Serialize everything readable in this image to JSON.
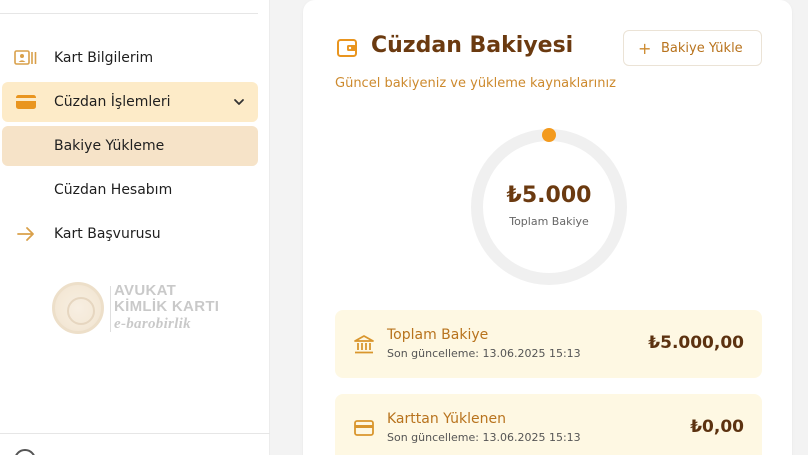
{
  "sidebar": {
    "items": [
      {
        "label": "Kart Bilgilerim",
        "icon": "id-card-icon"
      },
      {
        "label": "Cüzdan İşlemleri",
        "icon": "wallet-icon"
      },
      {
        "label": "Bakiye Yükleme"
      },
      {
        "label": "Cüzdan Hesabım"
      },
      {
        "label": "Kart Başvurusu",
        "icon": "arrow-right-icon"
      }
    ],
    "logo": {
      "line1": "AVUKAT",
      "line2": "KİMLİK KARTI",
      "line3": "e-barobirlik"
    }
  },
  "wallet": {
    "title": "Cüzdan Bakiyesi",
    "subtitle": "Güncel bakiyeniz ve yükleme kaynaklarınız",
    "load_button": "Bakiye Yükle",
    "total_display": "₺5.000",
    "total_label": "Toplam Bakiye",
    "balances": [
      {
        "title": "Toplam Bakiye",
        "updated": "Son güncelleme: 13.06.2025 15:13",
        "value": "₺5.000,00",
        "icon": "bank-icon"
      },
      {
        "title": "Karttan Yüklenen",
        "updated": "Son güncelleme: 13.06.2025 15:13",
        "value": "₺0,00",
        "icon": "credit-card-icon"
      }
    ]
  },
  "colors": {
    "accent": "#f39a1e",
    "brand_dark": "#6b3a10",
    "active_bg": "#fdebc8",
    "card_bg": "#fef8e3"
  }
}
